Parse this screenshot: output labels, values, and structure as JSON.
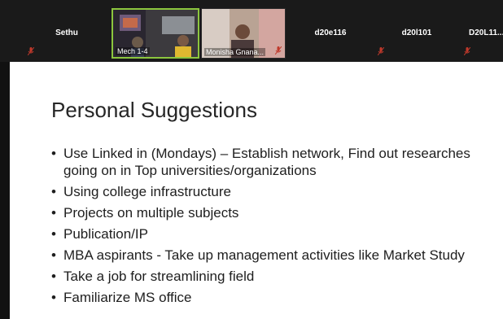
{
  "participants": [
    {
      "name": "Sethu",
      "muted": true
    },
    {
      "name": "Mech 1-4",
      "video": true
    },
    {
      "name": "Monisha Gnana...",
      "video": true
    },
    {
      "name": "d20e116",
      "muted": true
    },
    {
      "name": "d20l101",
      "muted": true
    },
    {
      "name": "D20L11...",
      "muted": true
    }
  ],
  "slide": {
    "title": "Personal Suggestions",
    "bullets": [
      "Use Linked in (Mondays) – Establish network, Find out researches going on in Top universities/organizations",
      "Using college infrastructure",
      "Projects on multiple subjects",
      "Publication/IP",
      "MBA aspirants - Take up management activities like Market Study",
      "Take a job for streamlining field",
      "Familiarize MS office"
    ]
  },
  "colors": {
    "active_speaker_border": "#8cc63e",
    "muted_icon": "#c0392b"
  }
}
